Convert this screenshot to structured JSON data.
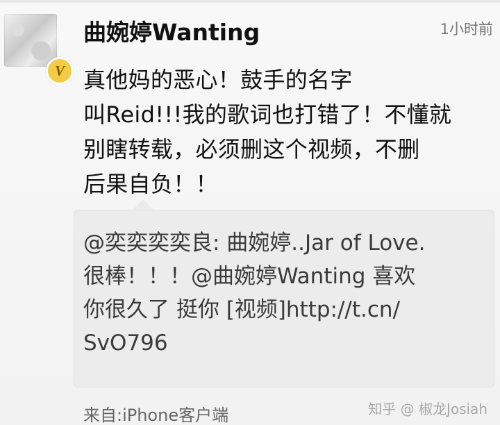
{
  "post": {
    "username": "曲婉婷Wanting",
    "time": "1小时前",
    "body_lines": [
      "真他妈的恶心！鼓手的名字",
      "叫Reid!!!我的歌词也打错了！不懂就",
      "别瞎转载，必须删这个视频，不删",
      "后果自负！！"
    ],
    "repost_lines": [
      "@奕奕奕奕良: 曲婉婷..Jar of Love.",
      "很棒！！！@曲婉婷Wanting 喜欢",
      "你很久了 挺你 [视频]http://t.cn/",
      "SvO796"
    ],
    "source": "来自:iPhone客户端"
  },
  "badge": {
    "label": "V",
    "color": "#f1cc44"
  },
  "watermark": {
    "text": "知乎 @ 椒龙Josiah",
    "icon": "pen-icon"
  }
}
